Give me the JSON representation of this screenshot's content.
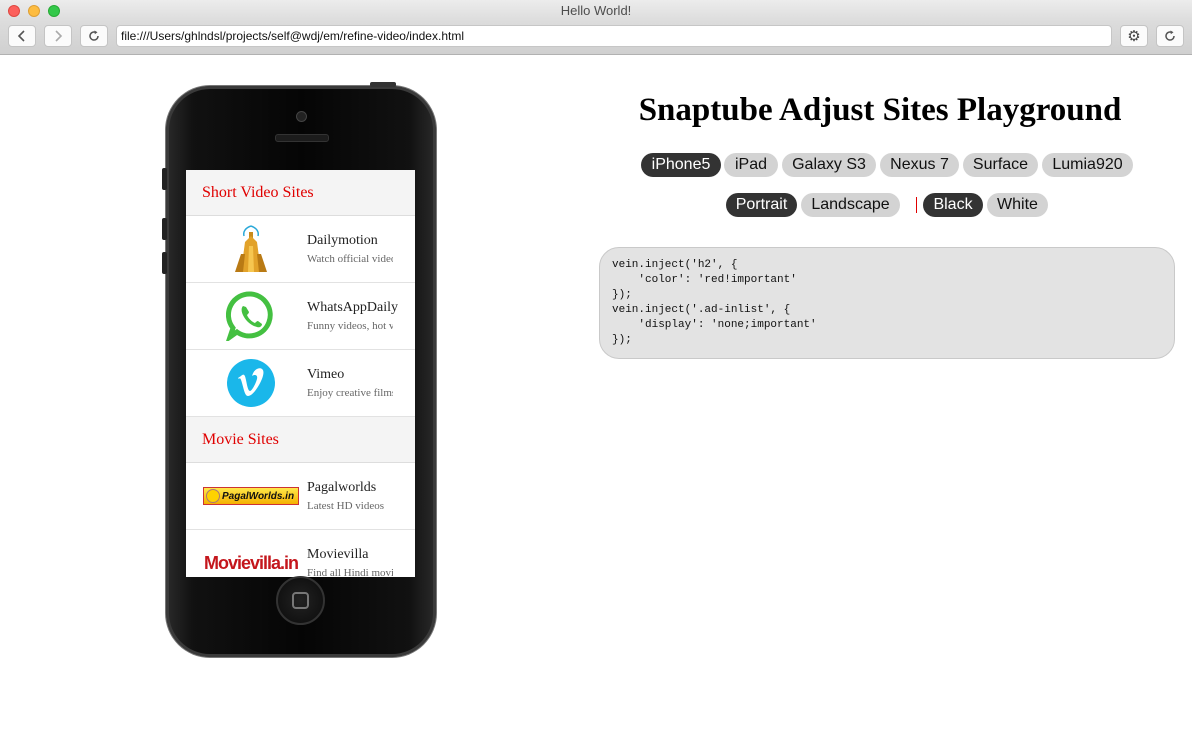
{
  "window": {
    "title": "Hello World!"
  },
  "toolbar": {
    "url": "file:///Users/ghlndsl/projects/self@wdj/em/refine-video/index.html",
    "back_icon": "chevron-left-icon",
    "forward_icon": "chevron-right-icon",
    "reload_icon": "reload-icon",
    "settings_icon": "gear-icon"
  },
  "playground": {
    "heading": "Snaptube Adjust Sites Playground",
    "devices": [
      {
        "label": "iPhone5",
        "active": true
      },
      {
        "label": "iPad",
        "active": false
      },
      {
        "label": "Galaxy S3",
        "active": false
      },
      {
        "label": "Nexus 7",
        "active": false
      },
      {
        "label": "Surface",
        "active": false
      },
      {
        "label": "Lumia920",
        "active": false
      }
    ],
    "orientations": [
      {
        "label": "Portrait",
        "active": true
      },
      {
        "label": "Landscape",
        "active": false
      }
    ],
    "separator": "|",
    "themes": [
      {
        "label": "Black",
        "active": true
      },
      {
        "label": "White",
        "active": false
      }
    ],
    "code": "vein.inject('h2', {\n    'color': 'red!important'\n});\nvein.inject('.ad-inlist', {\n    'display': 'none;important'\n});"
  },
  "phone": {
    "sections": [
      {
        "title": "Short Video Sites",
        "items": [
          {
            "name": "Dailymotion",
            "desc": "Watch official videos",
            "icon": "dailymotion-logo"
          },
          {
            "name": "WhatsAppDaily",
            "desc": "Funny videos, hot videos",
            "icon": "whatsapp-logo"
          },
          {
            "name": "Vimeo",
            "desc": "Enjoy creative films",
            "icon": "vimeo-logo"
          }
        ]
      },
      {
        "title": "Movie Sites",
        "items": [
          {
            "name": "Pagalworlds",
            "desc": "Latest HD videos",
            "icon": "pagalworlds-logo",
            "logo_text": "PagalWorlds.in"
          },
          {
            "name": "Movievilla",
            "desc": "Find all Hindi movies",
            "icon": "movievilla-logo",
            "logo_text": "Movievilla.in"
          }
        ]
      }
    ]
  },
  "colors": {
    "section_title": "#e00000",
    "pill_active_bg": "#333333",
    "pill_bg": "#d3d3d3",
    "code_bg": "#e3e3e3"
  }
}
